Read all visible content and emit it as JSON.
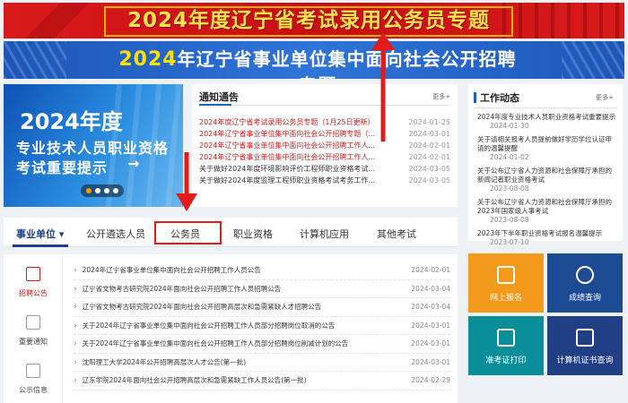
{
  "banner1": {
    "title": "2024年度辽宁省考试录用公务员专题"
  },
  "banner2": {
    "year": "2024",
    "title": "年辽宁省事业单位集中面向社会公开招聘专题"
  },
  "promo": {
    "year": "2024年度",
    "line1": "专业技术人员职业资格",
    "line2": "考试重要提示",
    "arrow": "→"
  },
  "notice": {
    "heading": "通知通告",
    "more": "更多+",
    "items": [
      {
        "title": "2024年度辽宁省考试录用公务员专题（1月25日更新）",
        "date": "2024-01-25"
      },
      {
        "title": "2024年辽宁省事业单位集中面向社会公开招聘专题（...",
        "date": "2024-03-01"
      },
      {
        "title": "2024年辽宁省事业单位集中面向社会公开招聘工作人...",
        "date": "2024-02-01"
      },
      {
        "title": "2024年辽宁省事业单位集中面向社会公开招聘工作人...",
        "date": "2024-02-01"
      },
      {
        "title": "关于做好2024年度环境影响评价工程师职业资格考试...",
        "date": "2024-03-05"
      },
      {
        "title": "关于做好2024年度监理工程师职业资格考试考务工作...",
        "date": "2024-03-05"
      }
    ]
  },
  "work": {
    "heading": "工作动态",
    "more": "更多+",
    "items": [
      {
        "title": "2024年度专业技术人员职业资格考试重要提示",
        "date": "2024-01-30"
      },
      {
        "title": "关于请相关报考人员提前做好学历学位认证申请的温馨提醒",
        "date": "2024-01-02"
      },
      {
        "title": "关于公布辽宁省人力资源和社会保障厅承担的新闻记者职业资格考试",
        "date": "2023-08-08"
      },
      {
        "title": "关于公布辽宁省人力资源和社会保障厅承担的2023年国家级人事考试",
        "date": "2023-08-08"
      },
      {
        "title": "2023年下半年职业资格考试报名温馨提示",
        "date": "2023-07-10"
      }
    ]
  },
  "tabs": {
    "items": [
      {
        "label": "事业单位 ▾"
      },
      {
        "label": "公开遴选人员"
      },
      {
        "label": "公务员"
      },
      {
        "label": "职业资格"
      },
      {
        "label": "计算机应用"
      },
      {
        "label": "其他考试"
      }
    ]
  },
  "side": {
    "items": [
      {
        "label": "招聘公告"
      },
      {
        "label": "重要通知"
      },
      {
        "label": "公示信息"
      }
    ]
  },
  "list": {
    "rows": [
      {
        "title": "2024年辽宁省事业单位集中面向社会公开招聘工作人员公告",
        "date": "2024-02-01"
      },
      {
        "title": "辽宁省文物考古研究院2024年面向社会公开招聘工作人员招聘公告",
        "date": "2024-03-04"
      },
      {
        "title": "辽宁省文物考古研究院2024年面向社会公开招聘高层次和急需紧缺人才招聘公告",
        "date": "2024-03-04"
      },
      {
        "title": "关于2024年辽宁省事业单位集中面向社会公开招聘工作人员部分招聘岗位取消的公告",
        "date": "2024-03-01"
      },
      {
        "title": "关于2024年辽宁省事业单位集中面向社会公开招聘工作人员部分招聘岗位削减计划的公告",
        "date": "2024-03-01"
      },
      {
        "title": "沈阳理工大学2024年公开招聘高层次人才公告(第一批)",
        "date": "2024-03-01"
      },
      {
        "title": "辽东学院2024年面向社会公开招聘高层次和急需紧缺工作人员公告(第一批)",
        "date": "2024-02-29"
      }
    ]
  },
  "tiles": {
    "items": [
      {
        "label": "网上报名",
        "color": "#f39a1d"
      },
      {
        "label": "成绩查询",
        "color": "#1c4b94"
      },
      {
        "label": "准考证打印",
        "color": "#0a8e99"
      },
      {
        "label": "计算机证书查询",
        "color": "#203f85"
      }
    ]
  },
  "colors": {
    "accent": "#1d3f8f",
    "highlight_red": "#e21b1b",
    "banner_red": "#d81a1a",
    "banner_blue": "#2f74d8"
  }
}
